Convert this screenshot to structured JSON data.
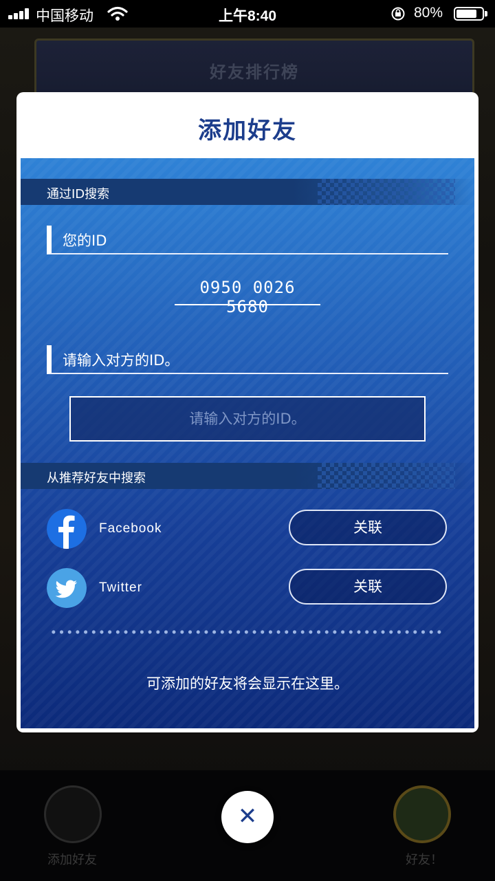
{
  "status_bar": {
    "carrier": "中国移动",
    "time": "上午8:40",
    "battery_percent": "80%",
    "battery_level": 0.8
  },
  "background": {
    "banner_text": "好友排行榜",
    "left_label": "添加好友",
    "right_label": "好友！"
  },
  "dialog": {
    "title": "添加好友",
    "search_by_id": {
      "section_label": "通过ID搜索",
      "your_id_label": "您的ID",
      "your_id_value": "0950 0026 5680",
      "other_id_label": "请输入对方的ID。",
      "input_placeholder": "请输入对方的ID。",
      "input_value": ""
    },
    "recommended": {
      "section_label": "从推荐好友中搜索",
      "accounts": [
        {
          "name": "Facebook",
          "button_label": "关联",
          "icon": "facebook-icon",
          "color": "#1877f2"
        },
        {
          "name": "Twitter",
          "button_label": "关联",
          "icon": "twitter-icon",
          "color": "#4aa3e6"
        }
      ],
      "empty_message": "可添加的好友将会显示在这里。"
    }
  },
  "close_button": {
    "symbol": "✕"
  }
}
